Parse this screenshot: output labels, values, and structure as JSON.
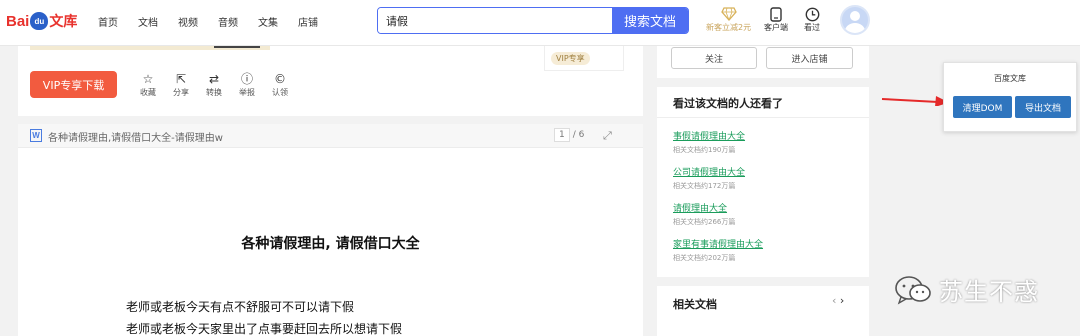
{
  "header": {
    "logo_bai": "Bai",
    "logo_du": "du",
    "logo_wenku": "文库",
    "nav": [
      "首页",
      "文档",
      "视频",
      "音频",
      "文集",
      "店铺"
    ],
    "search_value": "请假",
    "search_button": "搜索文档",
    "vip_hint": "新客立减2元",
    "client_label": "客户端",
    "history_label": "看过"
  },
  "doc": {
    "vip_thumb_label": "VIP专享",
    "vip_download": "VIP专享下载",
    "actions": [
      "收藏",
      "分享",
      "转换",
      "举报",
      "认领"
    ],
    "bar_title": "各种请假理由,请假借口大全-请假理由w",
    "page_current": "1",
    "page_total": "/ 6",
    "heading": "各种请假理由, 请假借口大全",
    "lines": [
      "老师或老板今天有点不舒服可不可以请下假",
      "老师或老板今天家里出了点事要赶回去所以想请下假"
    ]
  },
  "shop": {
    "follow": "关注",
    "enter_shop": "进入店铺"
  },
  "seen": {
    "title": "看过该文档的人还看了",
    "items": [
      {
        "title": "事假请假理由大全",
        "sub": "相关文档约190万篇"
      },
      {
        "title": "公司请假理由大全",
        "sub": "相关文档约172万篇"
      },
      {
        "title": "请假理由大全",
        "sub": "相关文档约266万篇"
      },
      {
        "title": "家里有事请假理由大全",
        "sub": "相关文档约202万篇"
      }
    ]
  },
  "related": {
    "title": "相关文档"
  },
  "extension": {
    "title": "百度文库",
    "clean_dom": "清理DOM",
    "export_doc": "导出文档"
  },
  "watermark": {
    "text": "苏生不惑"
  },
  "colors": {
    "accent_blue": "#4e6ef2",
    "vip_orange": "#f25b3f",
    "link_green": "#1a9c5b",
    "ext_blue": "#2f75be",
    "arrow_red": "#e52a2a"
  }
}
